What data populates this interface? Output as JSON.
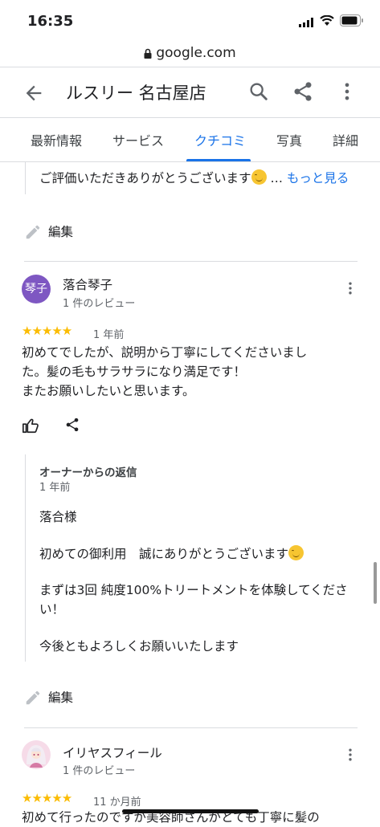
{
  "status_bar": {
    "time": "16:35"
  },
  "url_bar": {
    "domain": "google.com"
  },
  "header": {
    "title": "ルスリー 名古屋店"
  },
  "tabs": [
    {
      "label": "最新情報"
    },
    {
      "label": "サービス"
    },
    {
      "label": "クチコミ",
      "active": true
    },
    {
      "label": "写真"
    },
    {
      "label": "詳細"
    }
  ],
  "prev_reply": {
    "text": "ご評価いただきありがとうございます",
    "more": "もっと見る"
  },
  "edit_label": "編集",
  "reviews": [
    {
      "avatar_text": "琴子",
      "avatar_color": "#7e57c2",
      "name": "落合琴子",
      "count": "1 件のレビュー",
      "rating": 5,
      "stars": "★★★★★",
      "time": "1 年前",
      "lines": [
        "初めてでしたが、説明から丁寧にしてくださいまし",
        "た。髪の毛もサラサラになり満足です！",
        "またお願いしたいと思います。"
      ],
      "reply": {
        "title": "オーナーからの返信",
        "time": "1 年前",
        "p1": "落合様",
        "p2": "初めての御利用　誠にありがとうございます",
        "p3a": "まずは3回 純度100%トリートメントを体験してくださ",
        "p3b": "い！",
        "p4": "今後ともよろしくお願いいたします"
      }
    },
    {
      "name": "イリヤスフィール",
      "count": "1 件のレビュー",
      "rating": 5,
      "stars": "★★★★★",
      "time": "11 か月前",
      "line1": "初めて行ったのですが美容師さんがとても丁寧に髪の"
    }
  ],
  "colors": {
    "accent": "#1a73e8",
    "star": "#fbbc04"
  }
}
